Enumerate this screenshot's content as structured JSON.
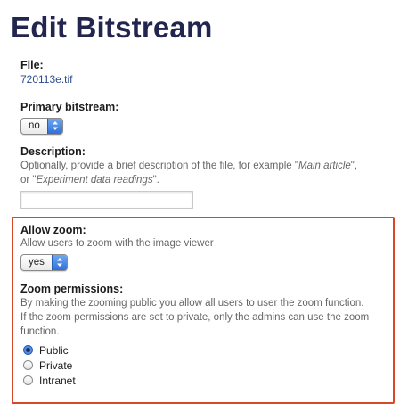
{
  "page": {
    "title": "Edit Bitstream"
  },
  "file": {
    "label": "File:",
    "value": "720113e.tif"
  },
  "primary_bitstream": {
    "label": "Primary bitstream:",
    "selected": "no"
  },
  "description": {
    "label": "Description:",
    "help_prefix": "Optionally, provide a brief description of the file, for example \"",
    "help_example1": "Main article",
    "help_middle": "\",",
    "help_line2_prefix": "or \"",
    "help_example2": "Experiment data readings",
    "help_suffix": "\".",
    "value": ""
  },
  "allow_zoom": {
    "label": "Allow zoom:",
    "help": "Allow users to zoom with the image viewer",
    "selected": "yes"
  },
  "zoom_permissions": {
    "label": "Zoom permissions:",
    "help_line1": "By making the zooming public you allow all users to user the zoom function.",
    "help_line2": "If the zoom permissions are set to private, only the admins can use the zoom",
    "help_line3": "function.",
    "options": [
      {
        "label": "Public",
        "checked": true
      },
      {
        "label": "Private",
        "checked": false
      },
      {
        "label": "Intranet",
        "checked": false
      }
    ]
  },
  "colors": {
    "title": "#22264f",
    "highlight_border": "#d9472b",
    "link": "#2a4a8f"
  }
}
